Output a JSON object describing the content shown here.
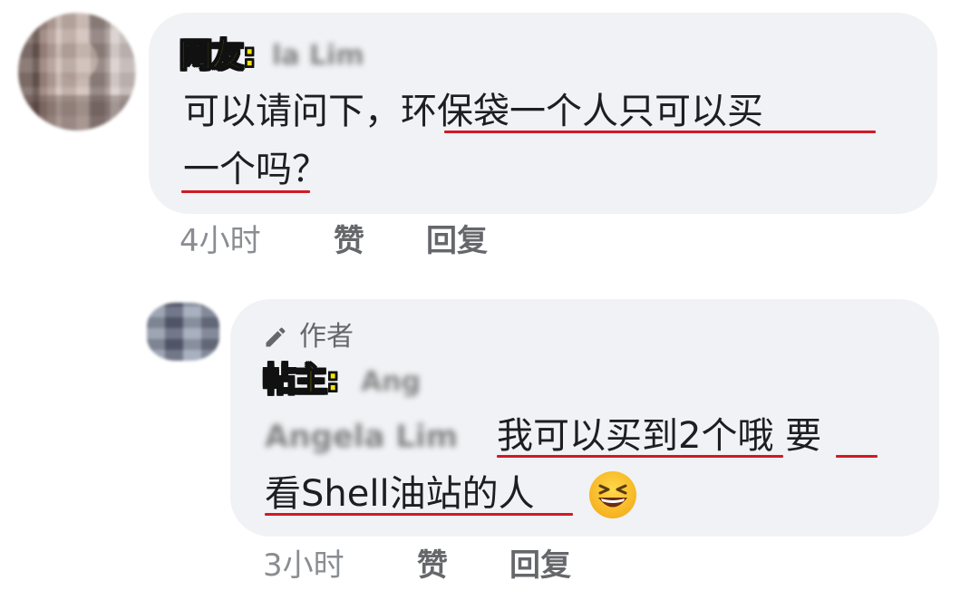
{
  "comment1": {
    "overlay_label": "网友:",
    "blurred_name": "la Lim",
    "text_line1_plain": "可以请问下，",
    "text_line1_underlined": "环保袋一个人只可以买",
    "text_line2_underlined": "一个吗",
    "text_line2_plain": "？",
    "time": "4小时",
    "like_label": "赞",
    "reply_label": "回复"
  },
  "comment2": {
    "author_badge": "作者",
    "overlay_label": "帖主:",
    "blurred_name": "Ang",
    "blurred_mention": "Angela Lim",
    "text_line1_underlined_a": "我可以买到2个",
    "text_line1_plain": "哦",
    "text_line1_underlined_b": "要",
    "text_line2_underlined": "看Shell油站的人",
    "emoji_icon": "laughing-squint-emoji",
    "time": "3小时",
    "like_label": "赞",
    "reply_label": "回复"
  },
  "colors": {
    "bubble_bg": "#f0f2f5",
    "underline": "#d11a24",
    "overlay_text": "#f6e500",
    "meta_text": "#8a8d91"
  }
}
